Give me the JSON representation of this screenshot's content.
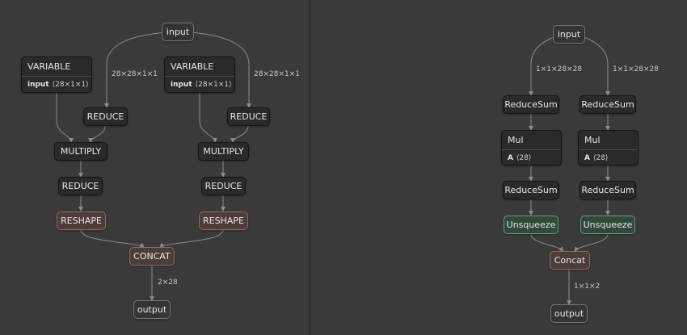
{
  "left_graph": {
    "input": "input",
    "var1": {
      "title": "VARIABLE",
      "attr_name": "input",
      "attr_value": "⟨28×1×1⟩"
    },
    "var2": {
      "title": "VARIABLE",
      "attr_name": "input",
      "attr_value": "⟨28×1×1⟩"
    },
    "reduce1": "REDUCE",
    "reduce2": "REDUCE",
    "multiply1": "MULTIPLY",
    "multiply2": "MULTIPLY",
    "reduce3": "REDUCE",
    "reduce4": "REDUCE",
    "reshape1": "RESHAPE",
    "reshape2": "RESHAPE",
    "concat": "CONCAT",
    "output": "output",
    "edge_labels": {
      "in_left": "28×28×1×1",
      "in_right": "28×28×1×1",
      "out": "2×28"
    }
  },
  "right_graph": {
    "input": "input",
    "reducesum1": "ReduceSum",
    "reducesum2": "ReduceSum",
    "mul1": {
      "title": "Mul",
      "attr_name": "A",
      "attr_value": "⟨28⟩"
    },
    "mul2": {
      "title": "Mul",
      "attr_name": "A",
      "attr_value": "⟨28⟩"
    },
    "reducesum3": "ReduceSum",
    "reducesum4": "ReduceSum",
    "unsqueeze1": "Unsqueeze",
    "unsqueeze2": "Unsqueeze",
    "concat": "Concat",
    "output": "output",
    "edge_labels": {
      "in_left": "1×1×28×28",
      "in_right": "1×1×28×28",
      "out": "1×1×2"
    }
  }
}
